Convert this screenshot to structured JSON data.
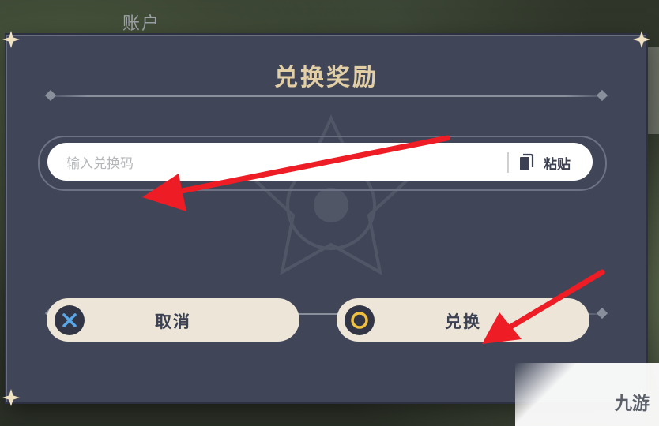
{
  "background": {
    "top_label": "账户"
  },
  "dialog": {
    "title": "兑换奖励",
    "input": {
      "placeholder": "输入兑换码"
    },
    "paste_label": "粘贴",
    "buttons": {
      "cancel_label": "取消",
      "confirm_label": "兑换"
    }
  },
  "watermark": {
    "text": "九游"
  },
  "colors": {
    "dialog_bg": "#404658",
    "title": "#e3cfa6",
    "button_bg": "#ece5d8",
    "annotation_arrow": "#ee1c25"
  },
  "icons": {
    "paste": "clipboard-icon",
    "cancel": "cross-icon",
    "confirm": "circle-icon",
    "corners": "star-icon"
  }
}
